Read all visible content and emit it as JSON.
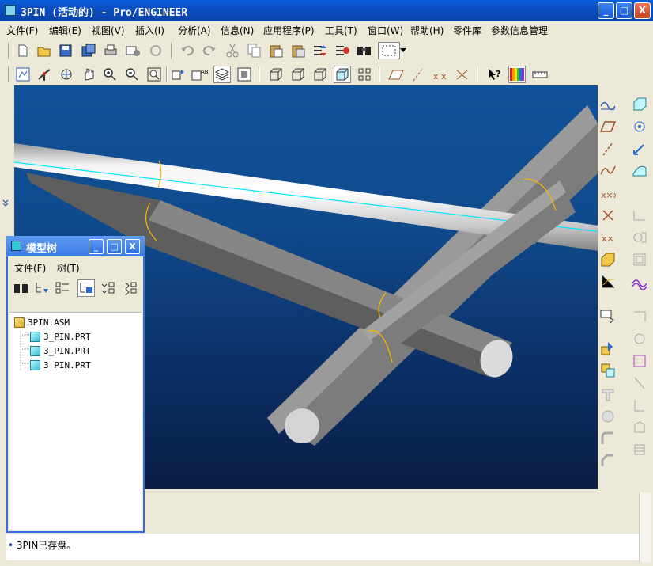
{
  "window": {
    "title": "3PIN (活动的) - Pro/ENGINEER",
    "buttons": {
      "minimize": "_",
      "maximize": "□",
      "close": "X"
    }
  },
  "menubar": {
    "items": [
      "文件(F)",
      "编辑(E)",
      "视图(V)",
      "插入(I)",
      "分析(A)",
      "信息(N)",
      "应用程序(P)",
      "工具(T)",
      "窗口(W)",
      "帮助(H)",
      "零件库",
      "参数信息管理"
    ]
  },
  "model_tree": {
    "title": "模型树",
    "menu": [
      "文件(F)",
      "树(T)"
    ],
    "items": [
      {
        "label": "3PIN.ASM",
        "type": "assembly"
      },
      {
        "label": "3_PIN.PRT",
        "type": "part"
      },
      {
        "label": "3_PIN.PRT",
        "type": "part"
      },
      {
        "label": "3_PIN.PRT",
        "type": "part"
      }
    ]
  },
  "message": {
    "text": "3PIN已存盘。"
  },
  "colors": {
    "titlebar": "#0b4fc4",
    "viewport_top": "#11529a",
    "viewport_bottom": "#0a1d45",
    "pin_highlight": "#00e5ff",
    "pin_edge": "#ffb400"
  },
  "icons": {
    "toolbar1": [
      "new-icon",
      "open-icon",
      "save-icon",
      "save-copy-icon",
      "print-icon",
      "send-icon",
      "regenerate-icon",
      "undo-icon",
      "redo-icon",
      "cut-icon",
      "copy-icon",
      "paste-icon",
      "paste-special-icon",
      "reorder-icon",
      "regen-manager-icon",
      "find-icon",
      "select-box-icon"
    ],
    "toolbar2": [
      "repaint-icon",
      "spin-center-icon",
      "orient-icon",
      "pan-icon",
      "zoom-in-icon",
      "zoom-out-icon",
      "refit-icon",
      "reorient-icon",
      "saved-views-icon",
      "layers-icon",
      "view-manager-icon",
      "wireframe-icon",
      "hidden-line-icon",
      "no-hidden-icon",
      "shading-icon",
      "display-style-icon",
      "datum-planes-icon",
      "datum-axes-icon",
      "datum-points-icon",
      "coord-sys-icon",
      "whats-this-icon",
      "color-appearance-icon",
      "measure-icon"
    ]
  }
}
